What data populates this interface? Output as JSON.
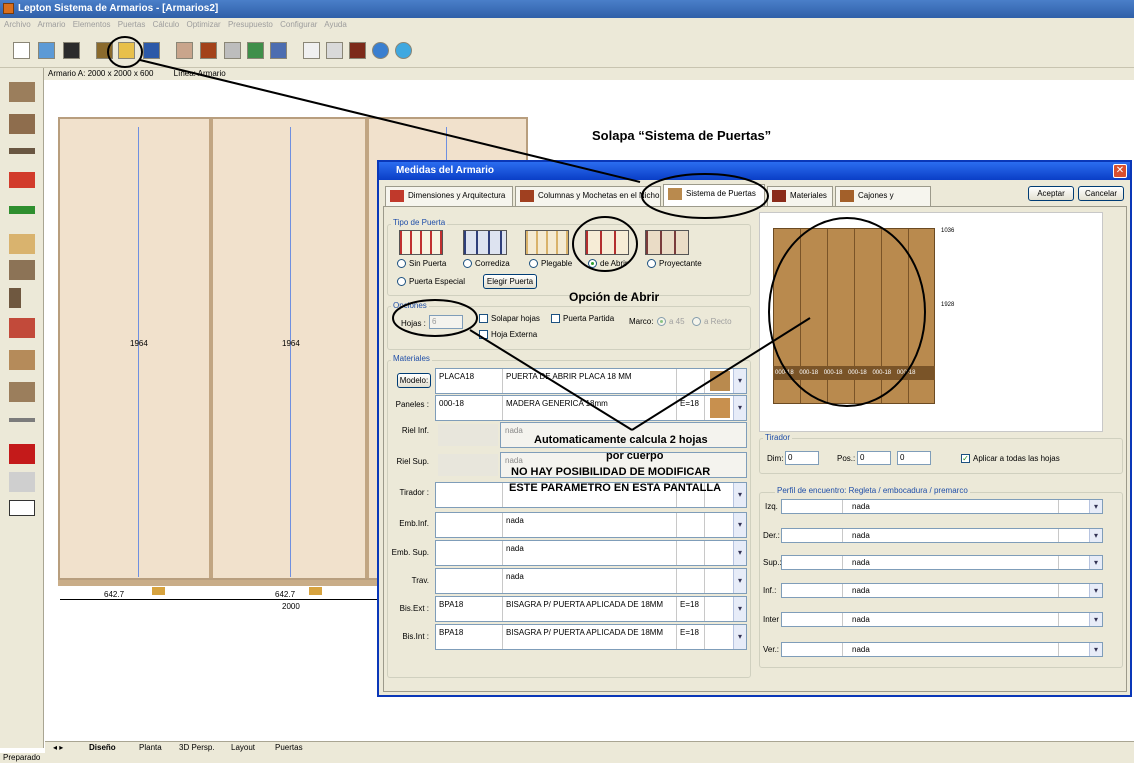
{
  "app": {
    "title": "Lepton Sistema de Armarios - [Armarios2]",
    "menu": [
      "Archivo",
      "Armario",
      "Elementos",
      "Puertas",
      "Cálculo",
      "Optimizar",
      "Presupuesto",
      "Configurar",
      "Ayuda"
    ],
    "info": [
      "Armario A: 2000 x 2000 x 600",
      "Línea: Armario"
    ],
    "status": "Preparado"
  },
  "drawing": {
    "dims": [
      "1964",
      "1964"
    ],
    "widths": [
      "642.7",
      "642.7"
    ],
    "total": "2000"
  },
  "bottom_tabs": [
    "Diseño",
    "Planta",
    "3D Persp.",
    "Layout",
    "Puertas"
  ],
  "dialog": {
    "title": "Medidas del Armario",
    "close": "✕",
    "tabs": [
      "Dimensiones y Arquitectura",
      "Columnas y Mochetas en el Nicho",
      "Sistema de Puertas",
      "Materiales",
      "Cajones y Cajoneras"
    ],
    "accept": "Aceptar",
    "cancel": "Cancelar",
    "tipo": {
      "legend": "Tipo de Puerta",
      "options": [
        "Sin Puerta",
        "Corrediza",
        "Plegable",
        "de Abrir",
        "Proyectante"
      ],
      "selected": "de Abrir",
      "special": "Puerta Especial",
      "choose": "Elegir Puerta"
    },
    "opciones": {
      "legend": "Opciones",
      "hojas_label": "Hojas :",
      "hojas_value": "6",
      "solapar": "Solapar hojas",
      "partida": "Puerta Partida",
      "externa": "Hoja Externa",
      "marco_label": "Marco:",
      "marco_a45": "a 45",
      "marco_recto": "a Recto"
    },
    "materiales": {
      "legend": "Materiales",
      "rows": [
        {
          "label": "Modelo:",
          "code": "PLACA18",
          "desc": "PUERTA DE ABRIR PLACA 18 MM",
          "extra": ""
        },
        {
          "label": "Paneles :",
          "code": "000-18",
          "desc": "MADERA GENERICA 18mm",
          "extra": "E=18"
        },
        {
          "label": "Riel Inf.",
          "code": "",
          "desc": "nada",
          "extra": ""
        },
        {
          "label": "Riel Sup.",
          "code": "",
          "desc": "nada",
          "extra": ""
        },
        {
          "label": "Tirador :",
          "code": "",
          "desc": "",
          "extra": ""
        },
        {
          "label": "Emb.Inf.",
          "code": "",
          "desc": "nada",
          "extra": ""
        },
        {
          "label": "Emb. Sup.",
          "code": "",
          "desc": "nada",
          "extra": ""
        },
        {
          "label": "Trav.",
          "code": "",
          "desc": "nada",
          "extra": ""
        },
        {
          "label": "Bis.Ext :",
          "code": "BPA18",
          "desc": "BISAGRA P/ PUERTA APLICADA DE 18MM",
          "extra": "E=18"
        },
        {
          "label": "Bis.Int :",
          "code": "BPA18",
          "desc": "BISAGRA P/ PUERTA APLICADA DE 18MM",
          "extra": "E=18"
        }
      ]
    },
    "preview": {
      "dims": [
        "1036",
        "1928"
      ],
      "labels": [
        "000-18",
        "000-18",
        "000-18",
        "000-18",
        "000-18",
        "000-18"
      ]
    },
    "tirador": {
      "legend": "Tirador",
      "dim_label": "Dim:",
      "dim_value": "0",
      "pos_label": "Pos.:",
      "pos_value": "0",
      "pos_value2": "0",
      "apply_all": "Aplicar a todas las hojas"
    },
    "encuentro": {
      "legend": "Perfil de encuentro: Regleta / embocadura / premarco",
      "rows": [
        {
          "label": "Izq.",
          "value": "nada"
        },
        {
          "label": "Der.:",
          "value": "nada"
        },
        {
          "label": "Sup.:",
          "value": "nada"
        },
        {
          "label": "Inf.:",
          "value": "nada"
        },
        {
          "label": "Inter",
          "value": "nada"
        },
        {
          "label": "Ver.:",
          "value": "nada"
        }
      ]
    }
  },
  "annotations": {
    "solapa": "Solapa “Sistema de Puertas”",
    "opcion": "Opción de Abrir",
    "auto_line1": "Automaticamente calcula 2 hojas",
    "auto_line2": "por cuerpo",
    "nohay_line1": "NO HAY POSIBILIDAD DE MODIFICAR",
    "nohay_line2": "ESTE PARAMETRO EN ESTA PANTALLA"
  },
  "colors": {
    "dialog_border": "#0a37b8",
    "wood": "#b98a4e",
    "door_tab_active": "#ffffff"
  }
}
